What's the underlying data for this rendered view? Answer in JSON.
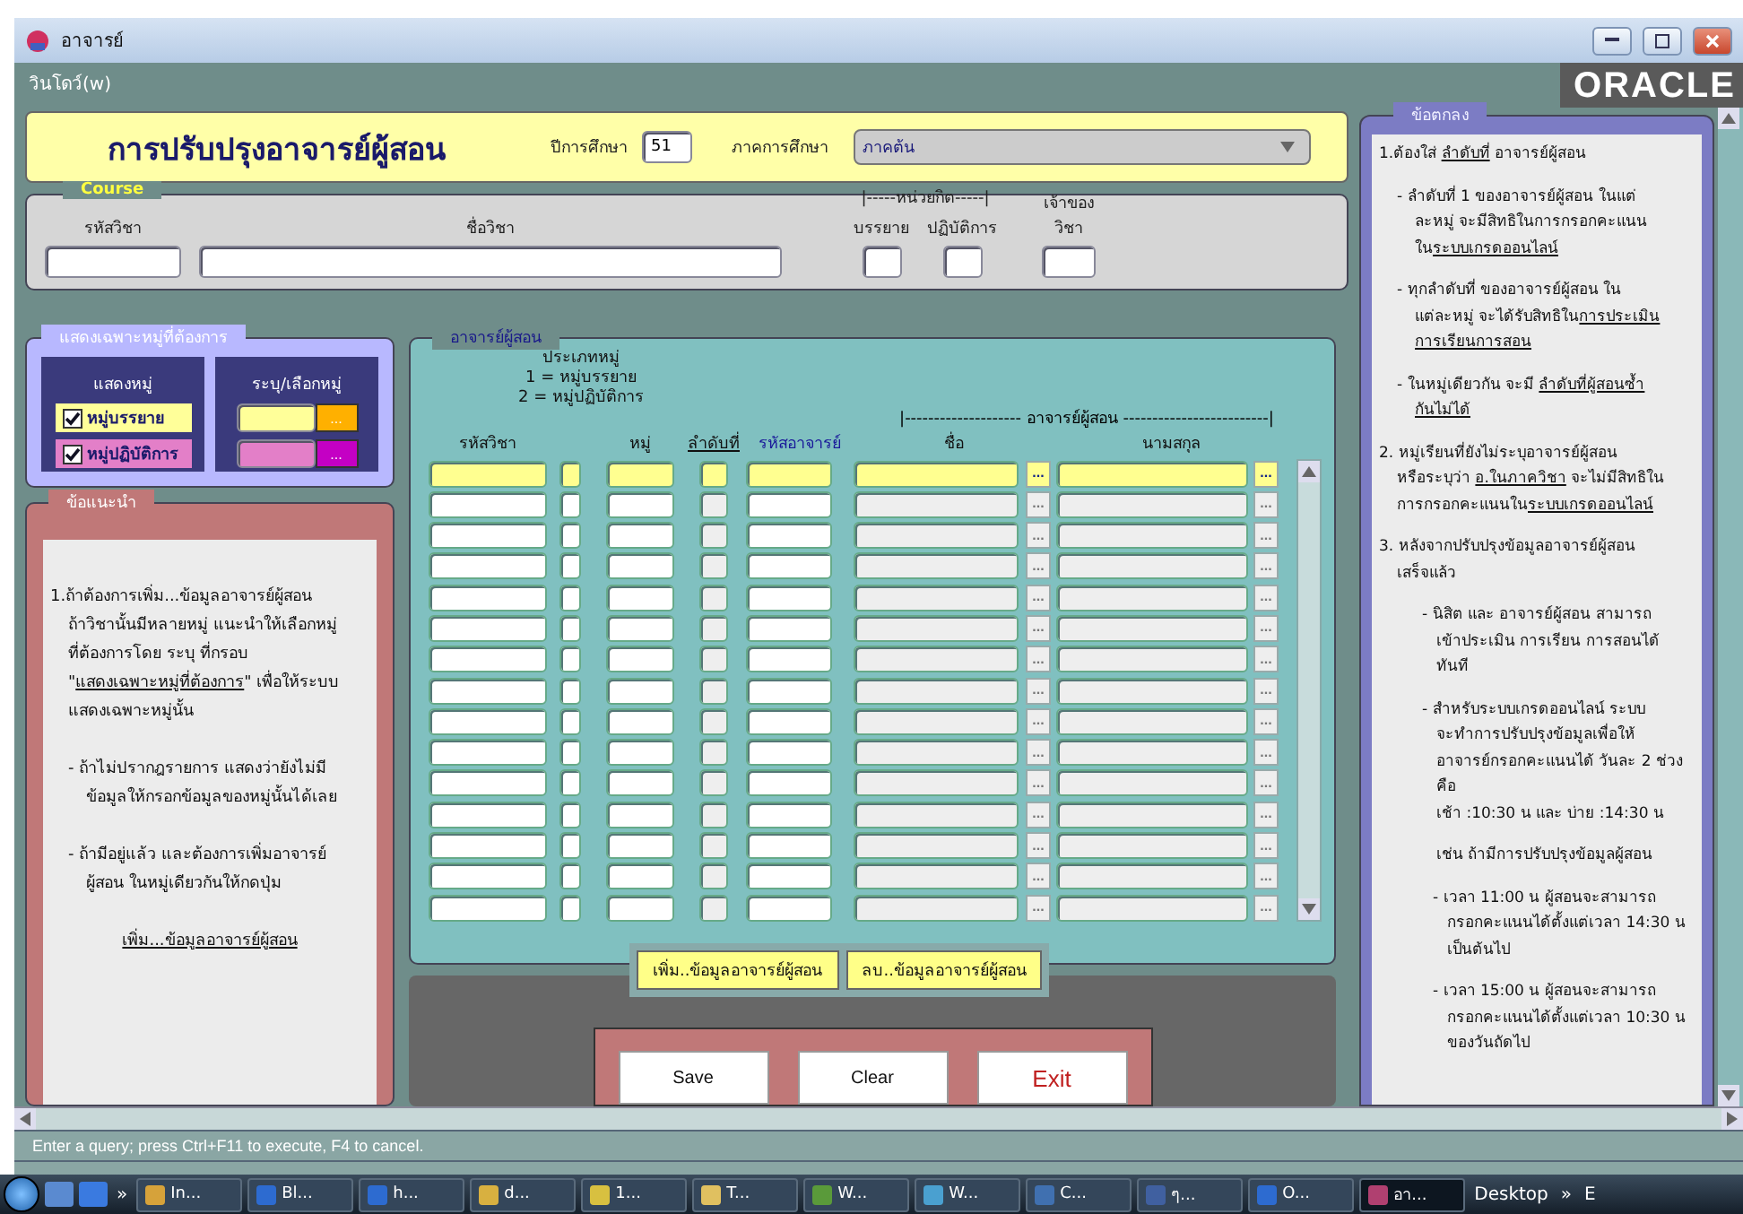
{
  "window": {
    "title": "อาจารย์",
    "menu": "วินโดว์(w)",
    "logo": "ORACLE"
  },
  "header": {
    "title": "การปรับปรุงอาจารย์ผู้สอน",
    "year_label": "ปีการศึกษา",
    "year": "51",
    "semester_label": "ภาคการศึกษา",
    "semester": "ภาคต้น"
  },
  "course": {
    "title": "Course",
    "code_label": "รหัสวิชา",
    "name_label": "ชื่อวิชา",
    "credit_label": "|-----หน่วยกิต-----|",
    "lecture_label": "บรรยาย",
    "lab_label": "ปฏิบัติการ",
    "owner_label": "เจ้าของ วิชา"
  },
  "filter": {
    "title": "แสดงเฉพาะหมู่ที่ต้องการ",
    "show_label": "แสดงหมู่",
    "pick_label": "ระบุ/เลือกหมู่",
    "groups": [
      {
        "label": "หมู่บรรยาย",
        "checked": true,
        "color": "#ffff99",
        "button": {
          "label": "...",
          "color": "#ffb000"
        }
      },
      {
        "label": "หมู่ปฏิบัติการ",
        "checked": true,
        "color": "#e37fc8",
        "button": {
          "label": "...",
          "color": "#c400c4"
        }
      }
    ]
  },
  "advice": {
    "title": "ข้อแนะนำ",
    "notes": [
      {
        "kind": "item",
        "lines": [
          [
            {
              "text": "1.ถ้าต้องการเพิ่ม...ข้อมูลอาจารย์ผู้สอน",
              "underline": false
            }
          ],
          [
            {
              "text": "ถ้าวิชานั้นมีหลายหมู่ แนะนำให้เลือกหมู่",
              "underline": false
            }
          ],
          [
            {
              "text": "ที่ต้องการโดย  ระบุ ที่กรอบ",
              "underline": false
            }
          ],
          [
            {
              "text": "\"",
              "underline": false
            },
            {
              "text": "แสดงเฉพาะหมู่ที่ต้องการ",
              "underline": true
            },
            {
              "text": "\" เพื่อให้ระบบ",
              "underline": false
            }
          ],
          [
            {
              "text": "แสดงเฉพาะหมู่นั้น",
              "underline": false
            }
          ]
        ]
      },
      {
        "kind": "sub",
        "lines": [
          [
            {
              "text": "- ถ้าไม่ปรากฎรายการ แสดงว่ายังไม่มี",
              "underline": false
            }
          ],
          [
            {
              "text": "ข้อมูลให้กรอกข้อมูลของหมู่นั้นได้เลย",
              "underline": false
            }
          ]
        ]
      },
      {
        "kind": "sub",
        "lines": [
          [
            {
              "text": "- ถ้ามีอยู่แล้ว และต้องการเพิ่มอาจารย์",
              "underline": false
            }
          ],
          [
            {
              "text": "ผู้สอน ในหมู่เดียวกันให้กดปุ่ม",
              "underline": false
            }
          ]
        ]
      },
      {
        "kind": "center",
        "lines": [
          [
            {
              "text": "เพิ่ม...ข้อมูลอาจารย์ผู้สอน",
              "underline": true
            }
          ]
        ]
      }
    ]
  },
  "grid": {
    "title": "อาจารย์ผู้สอน",
    "type_legend": [
      "ประเภทหมู่",
      "1 = หมู่บรรยาย",
      "2 = หมู่ปฏิบัติการ"
    ],
    "columns": {
      "course_code": "รหัสวิชา",
      "group": "หมู่",
      "order": "ลำดับที่",
      "teacher_code": "รหัสอาจารย์",
      "teacher_span": "|-------------------- อาจารย์ผู้สอน -------------------------|",
      "first_name": "ชื่อ",
      "last_name": "นามสกุล"
    },
    "records": [
      {
        "selected": true,
        "name_button": "...",
        "surname_button": "..."
      },
      {
        "selected": false,
        "name_button": "...",
        "surname_button": "..."
      },
      {
        "selected": false,
        "name_button": "...",
        "surname_button": "..."
      },
      {
        "selected": false,
        "name_button": "...",
        "surname_button": "..."
      },
      {
        "selected": false,
        "name_button": "...",
        "surname_button": "..."
      },
      {
        "selected": false,
        "name_button": "...",
        "surname_button": "..."
      },
      {
        "selected": false,
        "name_button": "...",
        "surname_button": "..."
      },
      {
        "selected": false,
        "name_button": "...",
        "surname_button": "..."
      },
      {
        "selected": false,
        "name_button": "...",
        "surname_button": "..."
      },
      {
        "selected": false,
        "name_button": "...",
        "surname_button": "..."
      },
      {
        "selected": false,
        "name_button": "...",
        "surname_button": "..."
      },
      {
        "selected": false,
        "name_button": "...",
        "surname_button": "..."
      },
      {
        "selected": false,
        "name_button": "...",
        "surname_button": "..."
      },
      {
        "selected": false,
        "name_button": "...",
        "surname_button": "..."
      },
      {
        "selected": false,
        "name_button": "...",
        "surname_button": "..."
      }
    ],
    "actions": [
      "เพิ่ม..ข้อมูลอาจารย์ผู้สอน",
      "ลบ..ข้อมูลอาจารย์ผู้สอน"
    ]
  },
  "buttons": [
    {
      "label": "Save",
      "kind": "normal"
    },
    {
      "label": "Clear",
      "kind": "normal"
    },
    {
      "label": "Exit",
      "kind": "danger"
    }
  ],
  "rules": {
    "title": "ข้อตกลง",
    "notes": [
      {
        "kind": "item",
        "lines": [
          [
            {
              "text": "1.ต้องใส่ ",
              "underline": false
            },
            {
              "text": "ลำดับที่",
              "underline": true
            },
            {
              "text": "  อาจารย์ผู้สอน",
              "underline": false
            }
          ]
        ]
      },
      {
        "kind": "sub",
        "lines": [
          [
            {
              "text": "- ลำดับที่ 1 ของอาจารย์ผู้สอน ในแต่",
              "underline": false
            }
          ],
          [
            {
              "text": "ละหมู่ จะมีสิทธิในการกรอกคะแนน",
              "underline": false
            }
          ],
          [
            {
              "text": "ใน",
              "underline": false
            },
            {
              "text": "ระบบเกรดออนไลน์",
              "underline": true
            }
          ]
        ]
      },
      {
        "kind": "sub",
        "lines": [
          [
            {
              "text": "- ทุกลำดับที่  ของอาจารย์ผู้สอน  ใน",
              "underline": false
            }
          ],
          [
            {
              "text": "แต่ละหมู่  จะได้รับสิทธิใน",
              "underline": false
            },
            {
              "text": "การประเมิน",
              "underline": true
            }
          ],
          [
            {
              "text": "การเรียนการสอน",
              "underline": true
            }
          ]
        ]
      },
      {
        "kind": "sub",
        "lines": [
          [
            {
              "text": "- ในหมู่เดียวกัน จะมี ",
              "underline": false
            },
            {
              "text": "ลำดับที่ผู้สอนซ้ำ",
              "underline": true
            }
          ],
          [
            {
              "text": "กันไม่ได้",
              "underline": true
            }
          ]
        ]
      },
      {
        "kind": "item",
        "lines": [
          [
            {
              "text": "2. หมู่เรียนที่ยังไม่ระบุอาจารย์ผู้สอน",
              "underline": false
            }
          ],
          [
            {
              "text": "หรือระบุว่า ",
              "underline": false
            },
            {
              "text": "อ.ในภาควิชา",
              "underline": true
            },
            {
              "text": " จะไม่มีสิทธิใน",
              "underline": false
            }
          ],
          [
            {
              "text": "การกรอกคะแนนใน",
              "underline": false
            },
            {
              "text": "ระบบเกรดออนไลน์",
              "underline": true
            }
          ]
        ]
      },
      {
        "kind": "item",
        "lines": [
          [
            {
              "text": "3. หลังจากปรับปรุงข้อมูลอาจารย์ผู้สอน",
              "underline": false
            }
          ],
          [
            {
              "text": "เสร็จแล้ว",
              "underline": false
            }
          ]
        ]
      },
      {
        "kind": "subsub",
        "lines": [
          [
            {
              "text": "- นิสิต และ อาจารย์ผู้สอน สามารถ",
              "underline": false
            }
          ],
          [
            {
              "text": "เข้าประเมิน การเรียน การสอนได้",
              "underline": false
            }
          ],
          [
            {
              "text": "ทันที",
              "underline": false
            }
          ]
        ]
      },
      {
        "kind": "subsub",
        "lines": [
          [
            {
              "text": "- สำหรับระบบเกรดออนไลน์ ระบบ",
              "underline": false
            }
          ],
          [
            {
              "text": "จะทำการปรับปรุงข้อมูลเพื่อให้",
              "underline": false
            }
          ],
          [
            {
              "text": "อาจารย์กรอกคะแนนได้ วันละ 2 ช่วง",
              "underline": false
            }
          ],
          [
            {
              "text": "คือ",
              "underline": false
            }
          ],
          [
            {
              "text": "เช้า :10:30 น และ บ่าย :14:30 น",
              "underline": false
            }
          ]
        ]
      },
      {
        "kind": "example",
        "lines": [
          [
            {
              "text": "เช่น ถ้ามีการปรับปรุงข้อมูลผู้สอน",
              "underline": false
            }
          ]
        ]
      },
      {
        "kind": "deep",
        "lines": [
          [
            {
              "text": "- เวลา 11:00 น  ผู้สอนจะสามารถ",
              "underline": false
            }
          ],
          [
            {
              "text": "กรอกคะแนนได้ตั้งแต่เวลา 14:30 น",
              "underline": false
            }
          ],
          [
            {
              "text": "เป็นต้นไป",
              "underline": false
            }
          ]
        ]
      },
      {
        "kind": "deep",
        "lines": [
          [
            {
              "text": "- เวลา 15:00 น  ผู้สอนจะสามารถ",
              "underline": false
            }
          ],
          [
            {
              "text": "กรอกคะแนนได้ตั้งแต่เวลา 10:30 น",
              "underline": false
            }
          ],
          [
            {
              "text": "ของวันถัดไป",
              "underline": false
            }
          ]
        ]
      }
    ]
  },
  "status_bar": "Enter a query;  press Ctrl+F11 to execute, F4 to cancel.",
  "taskbar": {
    "overflow": "»",
    "tasks": [
      {
        "label": "In...",
        "selected": false
      },
      {
        "label": "Bl...",
        "selected": false
      },
      {
        "label": "h...",
        "selected": false
      },
      {
        "label": "d...",
        "selected": false
      },
      {
        "label": "1...",
        "selected": false
      },
      {
        "label": "T...",
        "selected": false
      },
      {
        "label": "W...",
        "selected": false
      },
      {
        "label": "W...",
        "selected": false
      },
      {
        "label": "C...",
        "selected": false
      },
      {
        "label": "ๆ...",
        "selected": false
      },
      {
        "label": "O...",
        "selected": false
      },
      {
        "label": "อา...",
        "selected": true
      }
    ],
    "desktop": "Desktop",
    "desktop_overflow": "»",
    "edge": "E"
  }
}
